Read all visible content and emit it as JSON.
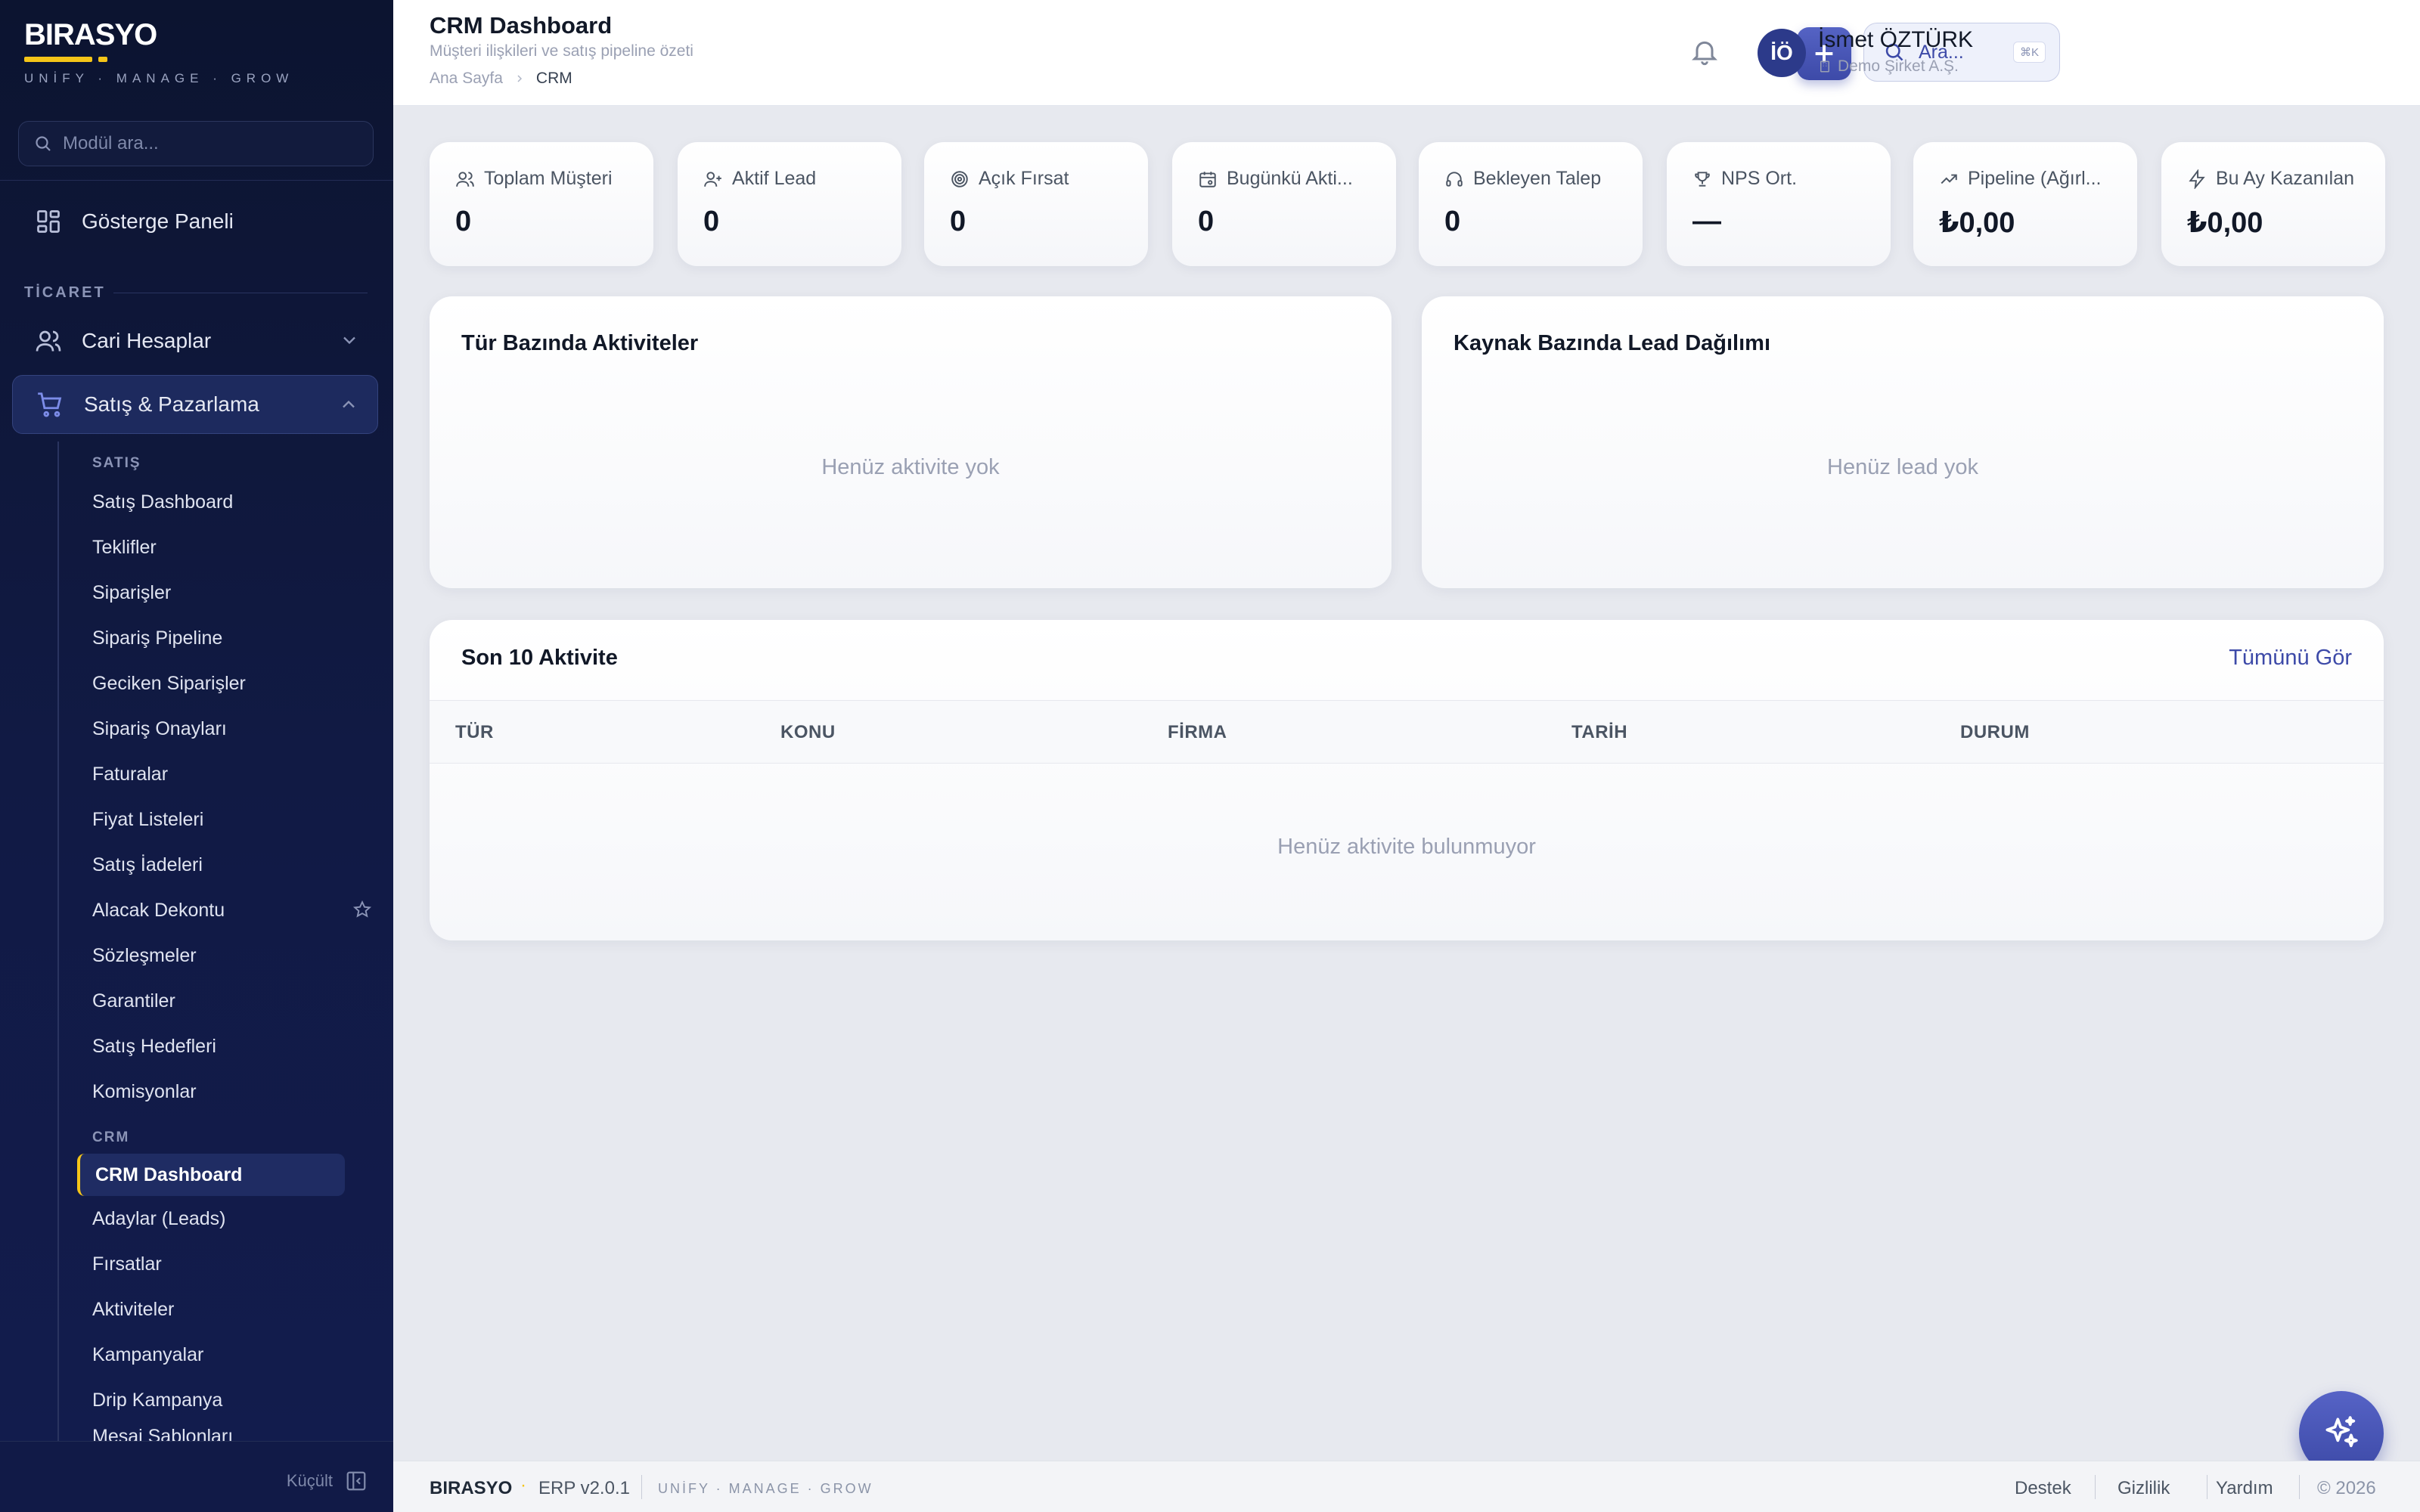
{
  "brand": {
    "name": "BIRASYO",
    "tagline": "UNİFY · MANAGE · GROW"
  },
  "sidebar": {
    "search_placeholder": "Modül ara...",
    "dashboard_label": "Gösterge Paneli",
    "section_ticaret": "TİCARET",
    "cari_label": "Cari Hesaplar",
    "satis_label": "Satış & Pazarlama",
    "group_satis": "SATIŞ",
    "satis_items": [
      "Satış Dashboard",
      "Teklifler",
      "Siparişler",
      "Sipariş Pipeline",
      "Geciken Siparişler",
      "Sipariş Onayları",
      "Faturalar",
      "Fiyat Listeleri",
      "Satış İadeleri",
      "Alacak Dekontu",
      "Sözleşmeler",
      "Garantiler",
      "Satış Hedefleri",
      "Komisyonlar"
    ],
    "group_crm": "CRM",
    "crm_items": [
      "CRM Dashboard",
      "Adaylar (Leads)",
      "Fırsatlar",
      "Aktiviteler",
      "Kampanyalar",
      "Drip Kampanya",
      "Mesaj Şablonları"
    ],
    "collapse_label": "Küçült"
  },
  "header": {
    "title": "CRM Dashboard",
    "subtitle": "Müşteri ilişkileri ve satış pipeline özeti",
    "breadcrumb_home": "Ana Sayfa",
    "breadcrumb_current": "CRM",
    "search_label": "Ara...",
    "search_shortcut": "⌘K",
    "user_initials": "İÖ",
    "user_name": "İsmet ÖZTÜRK",
    "user_company": "Demo Şirket A.Ş."
  },
  "stats": [
    {
      "label": "Toplam Müşteri",
      "value": "0",
      "icon": "users-icon"
    },
    {
      "label": "Aktif Lead",
      "value": "0",
      "icon": "user-plus-icon"
    },
    {
      "label": "Açık Fırsat",
      "value": "0",
      "icon": "target-icon"
    },
    {
      "label": "Bugünkü Akti...",
      "value": "0",
      "icon": "calendar-icon"
    },
    {
      "label": "Bekleyen Talep",
      "value": "0",
      "icon": "headset-icon"
    },
    {
      "label": "NPS Ort.",
      "value": "—",
      "icon": "trophy-icon"
    },
    {
      "label": "Pipeline (Ağırl...",
      "value": "₺0,00",
      "icon": "trending-up-icon"
    },
    {
      "label": "Bu Ay Kazanılan",
      "value": "₺0,00",
      "icon": "zap-icon"
    }
  ],
  "panels": {
    "activities_title": "Tür Bazında Aktiviteler",
    "activities_empty": "Henüz aktivite yok",
    "leads_title": "Kaynak Bazında Lead Dağılımı",
    "leads_empty": "Henüz lead yok"
  },
  "recent": {
    "title": "Son 10 Aktivite",
    "view_all": "Tümünü Gör",
    "columns": [
      "TÜR",
      "KONU",
      "FİRMA",
      "TARİH",
      "DURUM"
    ],
    "empty": "Henüz aktivite bulunmuyor"
  },
  "footer": {
    "brand": "BIRASYO",
    "dot": "·",
    "version": "ERP v2.0.1",
    "tagline": "UNİFY · MANAGE · GROW",
    "links": [
      "Destek",
      "Gizlilik",
      "Yardım"
    ],
    "copyright": "© 2026"
  },
  "colors": {
    "accent": "#3d4aa8",
    "brand_yellow": "#f5c518",
    "sidebar_bg": "#0c1430"
  }
}
